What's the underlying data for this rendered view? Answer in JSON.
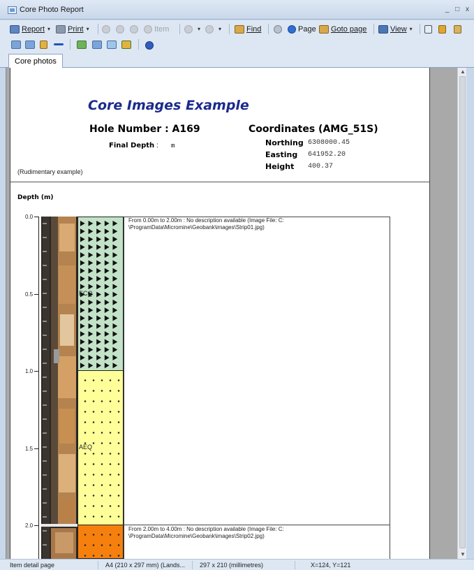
{
  "window": {
    "title": "Core Photo Report",
    "controls": "_ □ x"
  },
  "toolbar": {
    "report_label": "Report",
    "print_label": "Print",
    "item_label": "Item",
    "find_label": "Find",
    "page_label": "Page",
    "goto_label": "Goto page",
    "view_label": "View",
    "caret": "▾"
  },
  "tabs": [
    {
      "label": "Core photos"
    }
  ],
  "report": {
    "title": "Core Images Example",
    "hole_number": "Hole Number : A169",
    "coordinates_title": "Coordinates (AMG_51S)",
    "final_depth_label": "Final Depth",
    "final_depth_colon": ":",
    "final_depth_unit": "m",
    "northing_label": "Northing",
    "northing_value": "6308000.45",
    "easting_label": "Easting",
    "easting_value": "641952.20",
    "height_label": "Height",
    "height_value": "400.37",
    "note": "(Rudimentary example)"
  },
  "log": {
    "depth_label": "Depth (m)",
    "ticks": [
      "0.0",
      "0.5",
      "1.0",
      "1.5",
      "2.0"
    ],
    "lith_labels": [
      "ECQ",
      "AEQ"
    ],
    "descriptions": [
      {
        "line1": "From 0.00m to 2.00m : No description available (Image File: C:",
        "line2": "\\ProgramData\\Micromine\\Geobank\\images\\Strip01.jpg)"
      },
      {
        "line1": "From 2.00m to 4.00m : No description available (Image File: C:",
        "line2": "\\ProgramData\\Micromine\\Geobank\\images\\Strip02.jpg)"
      }
    ]
  },
  "statusbar": {
    "item": "Item detail page",
    "paper": "A4 (210 x 297 mm) (Lands...",
    "size": "297 x 210 (millimetres)",
    "coords": "X=124, Y=121"
  },
  "colors": {
    "title_blue": "#1b2a8c",
    "ecq_fill": "#c3e3c8",
    "aeq_fill": "#ffff9a",
    "orange_fill": "#f5800e"
  }
}
